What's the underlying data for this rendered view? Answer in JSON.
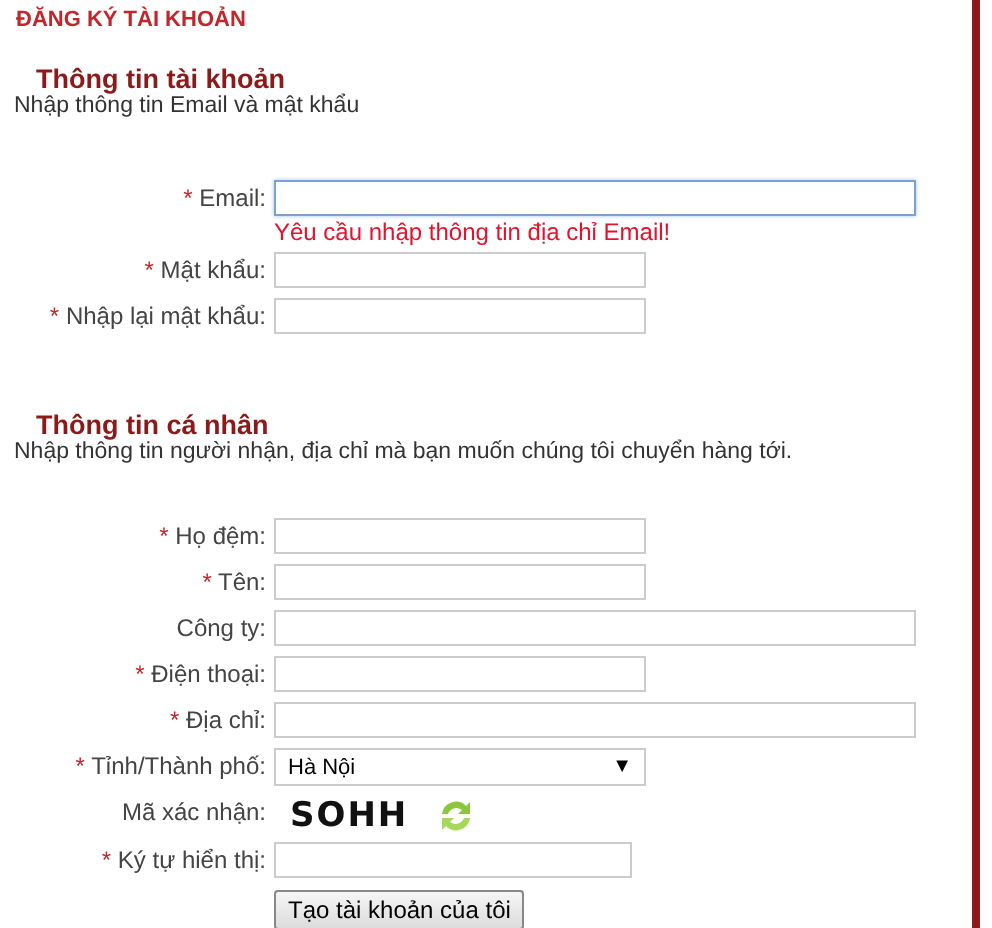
{
  "page_title": "ĐĂNG KÝ TÀI KHOẢN",
  "sections": [
    {
      "heading": "Thông tin tài khoản",
      "subtitle": "Nhập thông tin Email và mật khẩu",
      "fields": [
        {
          "kind": "wideinput",
          "marker": "*",
          "label": "Email:",
          "focused": true,
          "error": "Yêu cầu nhập thông tin địa chỉ Email!"
        },
        {
          "kind": "input",
          "marker": "*",
          "label": "Mật khẩu:",
          "focused": false
        },
        {
          "kind": "input",
          "marker": "*",
          "label": "Nhập lại mật khẩu:",
          "focused": false
        }
      ]
    },
    {
      "heading": "Thông tin cá nhân",
      "subtitle": "Nhập thông tin người nhận, địa chỉ mà bạn muốn chúng tôi chuyển hàng tới.",
      "fields": [
        {
          "kind": "input",
          "marker": "*",
          "label": "Họ đệm:",
          "focused": false
        },
        {
          "kind": "input",
          "marker": "*",
          "label": "Tên:",
          "focused": false
        },
        {
          "kind": "wideinput",
          "label": "Công ty:",
          "focused": false
        },
        {
          "kind": "input",
          "marker": "*",
          "label": "Điện thoại:",
          "focused": false
        },
        {
          "kind": "wideinput",
          "marker": "*",
          "label": "Địa chỉ:",
          "focused": false
        },
        {
          "kind": "select",
          "marker": "*",
          "label": "Tỉnh/Thành phố:",
          "value": "Hà Nội",
          "arrow": "▼"
        },
        {
          "kind": "captcha",
          "label": "Mã xác nhận:",
          "code": "SOHH"
        },
        {
          "kind": "captchainput",
          "marker": "*",
          "label": "Ký tự hiển thị:",
          "focused": false
        }
      ]
    }
  ],
  "submit_button": "Tạo tài khoản của tôi"
}
